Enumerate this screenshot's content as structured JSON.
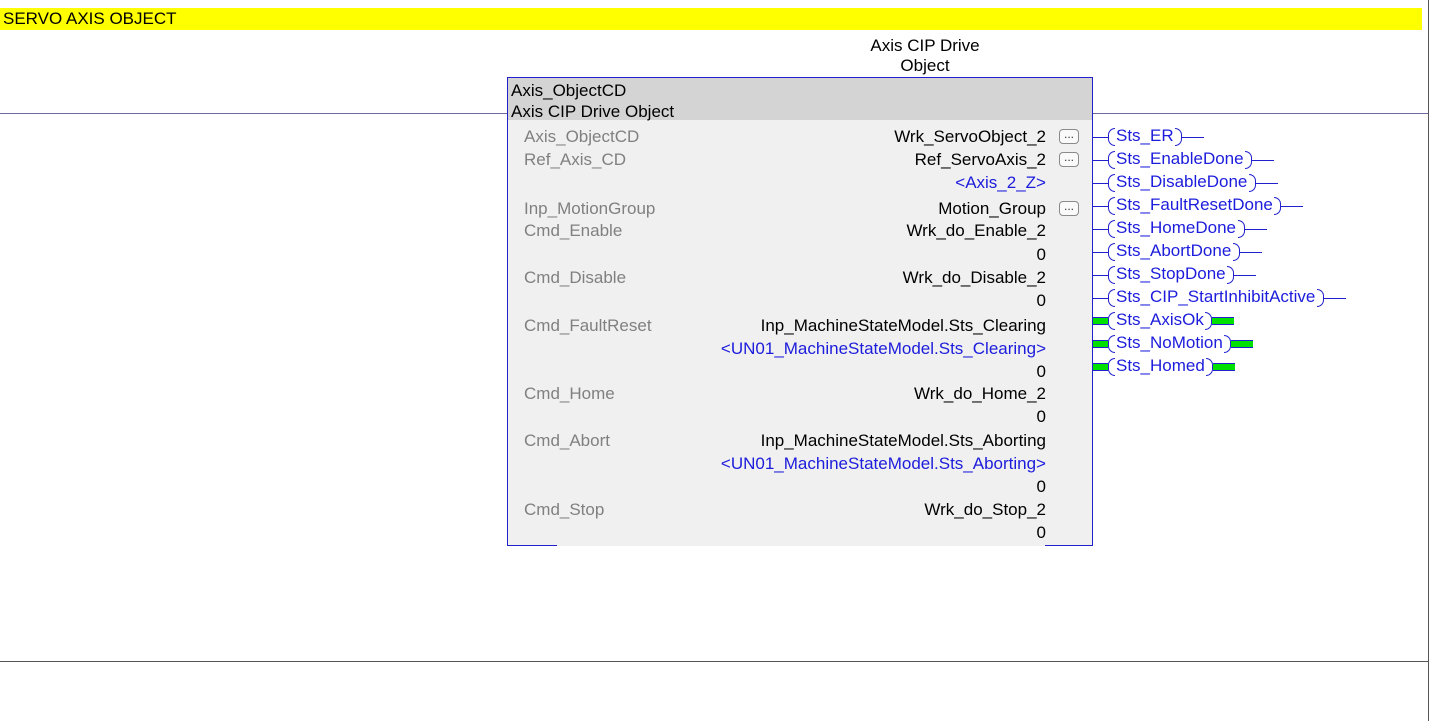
{
  "rung_comment": "SERVO AXIS OBJECT",
  "block_title": [
    "Axis CIP Drive",
    "Object"
  ],
  "block": {
    "header_name": "Axis_ObjectCD",
    "header_desc": "Axis CIP Drive Object",
    "params": [
      {
        "name": "Axis_ObjectCD",
        "value": "Wrk_ServoObject_2",
        "ellipsis": "..."
      },
      {
        "name": "Ref_Axis_CD",
        "value": "Ref_ServoAxis_2",
        "ellipsis": "...",
        "alias": "<Axis_2_Z>"
      },
      {
        "name": "Inp_MotionGroup",
        "value": "Motion_Group",
        "ellipsis": "..."
      },
      {
        "name": "Cmd_Enable",
        "value": "Wrk_do_Enable_2",
        "state": "0"
      },
      {
        "name": "Cmd_Disable",
        "value": "Wrk_do_Disable_2",
        "state": "0"
      },
      {
        "name": "Cmd_FaultReset",
        "value": "Inp_MachineStateModel.Sts_Clearing",
        "alias": "<UN01_MachineStateModel.Sts_Clearing>",
        "state": "0"
      },
      {
        "name": "Cmd_Home",
        "value": "Wrk_do_Home_2",
        "state": "0"
      },
      {
        "name": "Cmd_Abort",
        "value": "Inp_MachineStateModel.Sts_Aborting",
        "alias": "<UN01_MachineStateModel.Sts_Aborting>",
        "state": "0"
      },
      {
        "name": "Cmd_Stop",
        "value": "Wrk_do_Stop_2",
        "state": "0"
      }
    ]
  },
  "outputs": [
    {
      "label": "Sts_ER",
      "energized": false
    },
    {
      "label": "Sts_EnableDone",
      "energized": false
    },
    {
      "label": "Sts_DisableDone",
      "energized": false
    },
    {
      "label": "Sts_FaultResetDone",
      "energized": false
    },
    {
      "label": "Sts_HomeDone",
      "energized": false
    },
    {
      "label": "Sts_AbortDone",
      "energized": false
    },
    {
      "label": "Sts_StopDone",
      "energized": false
    },
    {
      "label": "Sts_CIP_StartInhibitActive",
      "energized": false
    },
    {
      "label": "Sts_AxisOk",
      "energized": true
    },
    {
      "label": "Sts_NoMotion",
      "energized": true
    },
    {
      "label": "Sts_Homed",
      "energized": true
    }
  ],
  "colors": {
    "comment_bg": "#ffff00",
    "wire": "#2020cc",
    "alias": "#1c1cdc",
    "energized": "#00e000"
  }
}
